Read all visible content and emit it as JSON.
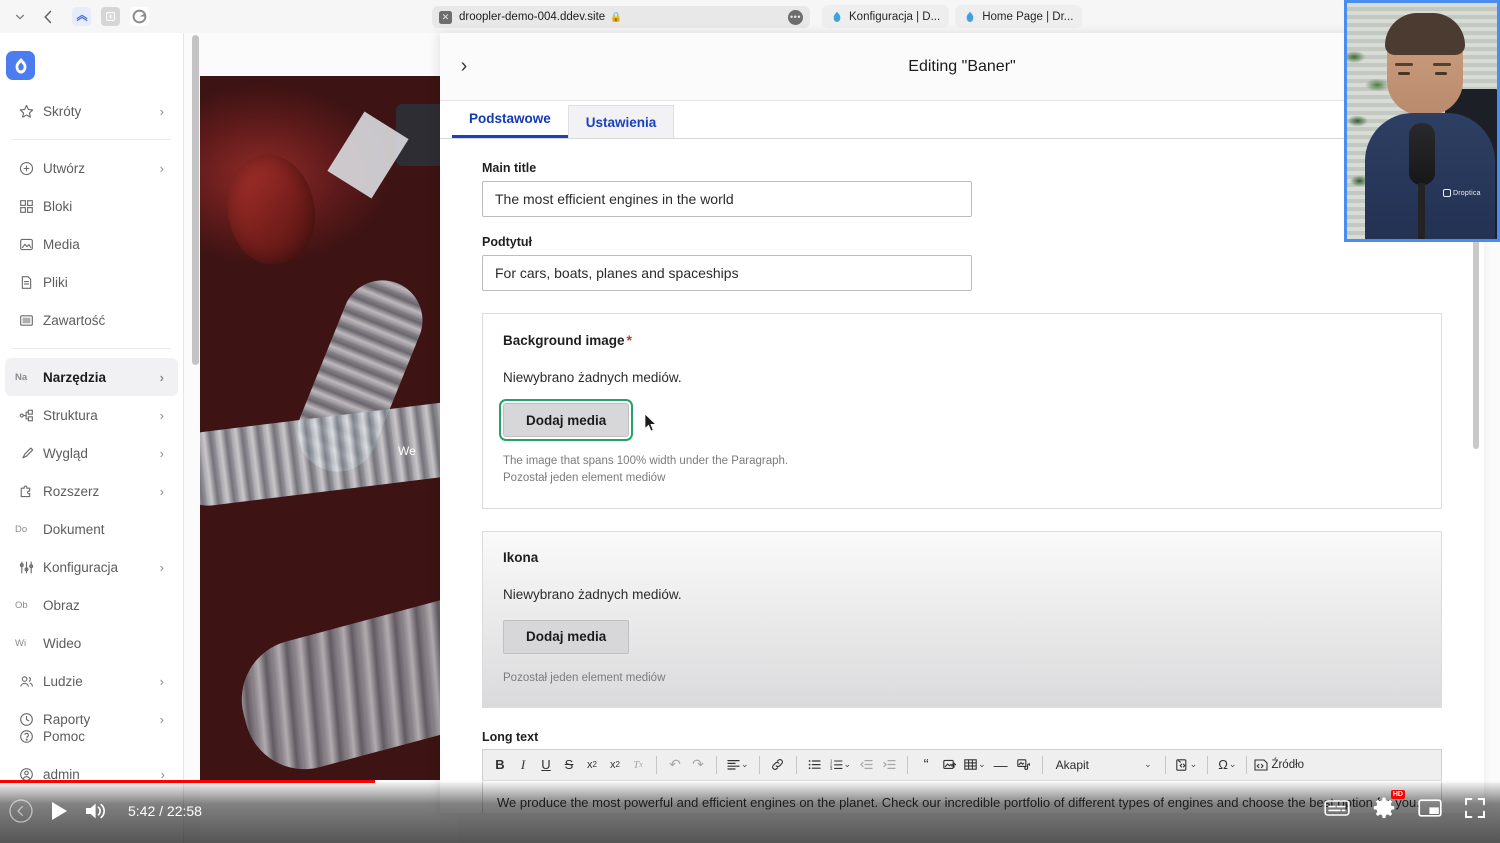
{
  "browser": {
    "toolbar_icons": [
      "sidebar-toggle-icon",
      "chevron-down-icon",
      "back-arrow-icon",
      "extension-icon-1",
      "extension-icon-2",
      "extension-icon-3"
    ],
    "address": {
      "close_glyph": "✕",
      "url": "droopler-demo-004.ddev.site",
      "lock_glyph": "🔒",
      "more_glyph": "•••"
    },
    "tabs": [
      {
        "label": "Konfiguracja | D..."
      },
      {
        "label": "Home Page | Dr..."
      }
    ]
  },
  "sidebar": {
    "logo_name": "drupal-logo",
    "items": [
      {
        "label": "Skróty",
        "icon": "star-icon",
        "chevron": "›",
        "active": false,
        "alt": ""
      },
      {
        "sep": true
      },
      {
        "label": "Utwórz",
        "icon": "plus-circle-icon",
        "chevron": "›",
        "active": false,
        "alt": ""
      },
      {
        "label": "Bloki",
        "icon": "blocks-icon",
        "chevron": "",
        "active": false,
        "alt": ""
      },
      {
        "label": "Media",
        "icon": "media-icon",
        "chevron": "",
        "active": false,
        "alt": ""
      },
      {
        "label": "Pliki",
        "icon": "files-icon",
        "chevron": "",
        "active": false,
        "alt": ""
      },
      {
        "label": "Zawartość",
        "icon": "content-icon",
        "chevron": "",
        "active": false,
        "alt": ""
      },
      {
        "sep": true
      },
      {
        "label": "Narzędzia",
        "icon": "",
        "chevron": "›",
        "active": true,
        "alt": "Na"
      },
      {
        "label": "Struktura",
        "icon": "structure-icon",
        "chevron": "›",
        "active": false,
        "alt": ""
      },
      {
        "label": "Wygląd",
        "icon": "brush-icon",
        "chevron": "›",
        "active": false,
        "alt": ""
      },
      {
        "label": "Rozszerz",
        "icon": "puzzle-icon",
        "chevron": "›",
        "active": false,
        "alt": ""
      },
      {
        "label": "Dokument",
        "icon": "",
        "chevron": "",
        "active": false,
        "alt": "Do"
      },
      {
        "label": "Konfiguracja",
        "icon": "sliders-icon",
        "chevron": "›",
        "active": false,
        "alt": ""
      },
      {
        "label": "Obraz",
        "icon": "",
        "chevron": "",
        "active": false,
        "alt": "Ob"
      },
      {
        "label": "Wideo",
        "icon": "",
        "chevron": "",
        "active": false,
        "alt": "Wi"
      },
      {
        "label": "Ludzie",
        "icon": "people-icon",
        "chevron": "›",
        "active": false,
        "alt": ""
      },
      {
        "label": "Raporty",
        "icon": "reports-icon",
        "chevron": "›",
        "active": false,
        "alt": ""
      }
    ],
    "bottom_items": [
      {
        "label": "Pomoc",
        "icon": "question-circle-icon",
        "chevron": ""
      },
      {
        "label": "admin",
        "icon": "user-circle-icon",
        "chevron": "›"
      }
    ]
  },
  "page": {
    "hero_text": "We"
  },
  "modal": {
    "close_glyph": "›",
    "title": "Editing \"Baner\"",
    "tabs": [
      {
        "label": "Podstawowe",
        "selected": true
      },
      {
        "label": "Ustawienia",
        "selected": false
      }
    ],
    "fields": {
      "main_title": {
        "label": "Main title",
        "value": "The most efficient engines in the world"
      },
      "subtitle": {
        "label": "Podtytuł",
        "value": "For cars, boats, planes and spaceships"
      }
    },
    "background_image": {
      "label": "Background image",
      "required_mark": "*",
      "empty_text": "Niewybrano żadnych mediów.",
      "button_label": "Dodaj media",
      "description_line1": "The image that spans 100% width under the Paragraph.",
      "description_line2": "Pozostał jeden element mediów"
    },
    "icon_field": {
      "label": "Ikona",
      "empty_text": "Niewybrano żadnych mediów.",
      "button_label": "Dodaj media",
      "description_line1": "Pozostał jeden element mediów"
    },
    "long_text": {
      "label": "Long text",
      "toolbar": [
        {
          "name": "bold-icon",
          "glyph": "B",
          "style": "bold"
        },
        {
          "name": "italic-icon",
          "glyph": "I",
          "style": "italic"
        },
        {
          "name": "underline-icon",
          "glyph": "U",
          "style": "underline"
        },
        {
          "name": "strikethrough-icon",
          "glyph": "S",
          "style": "strike"
        },
        {
          "name": "superscript-icon",
          "glyph": "x²",
          "style": ""
        },
        {
          "name": "subscript-icon",
          "glyph": "x₂",
          "style": ""
        },
        {
          "name": "remove-format-icon",
          "glyph": "Tₓ",
          "style": "dim"
        },
        {
          "sep": true
        },
        {
          "name": "undo-icon",
          "glyph": "↩",
          "style": "dim"
        },
        {
          "name": "redo-icon",
          "glyph": "↪",
          "style": "dim"
        },
        {
          "sep": true
        },
        {
          "name": "align-icon",
          "glyph": "≡",
          "style": "",
          "caret": true
        },
        {
          "sep": true
        },
        {
          "name": "link-icon",
          "glyph": "🔗",
          "style": ""
        },
        {
          "sep": true
        },
        {
          "name": "bulleted-list-icon",
          "glyph": "☰",
          "style": ""
        },
        {
          "name": "numbered-list-icon",
          "glyph": "≡",
          "style": "",
          "caret": true
        },
        {
          "name": "outdent-icon",
          "glyph": "←≡",
          "style": "dim"
        },
        {
          "name": "indent-icon",
          "glyph": "→≡",
          "style": "dim"
        },
        {
          "sep": true
        },
        {
          "name": "blockquote-icon",
          "glyph": "“",
          "style": ""
        },
        {
          "name": "insert-image-icon",
          "glyph": "▣",
          "style": ""
        },
        {
          "name": "insert-table-icon",
          "glyph": "▦",
          "style": "",
          "caret": true
        },
        {
          "name": "horizontal-rule-icon",
          "glyph": "—",
          "style": ""
        },
        {
          "name": "media-embed-icon",
          "glyph": "❖",
          "style": ""
        }
      ],
      "paragraph_select": {
        "value": "Akapit",
        "caret": "∨"
      },
      "template_icon": {
        "name": "template-icon",
        "caret": "∨"
      },
      "special_char": {
        "name": "special-character-icon",
        "glyph": "Ω",
        "caret": "∨"
      },
      "source_button": {
        "name": "source-button",
        "label": "Źródło",
        "glyph": "‹›"
      },
      "body_text": "We produce the most powerful and efficient engines on the planet. Check our incredible portfolio of different types of engines and choose the best option for you."
    }
  },
  "webcam": {
    "brand_label": "Droptica"
  },
  "player": {
    "prev_icon": "previous-icon",
    "play_icon": "play-icon",
    "volume_icon": "volume-icon",
    "time": "5:42 / 22:58",
    "progress_percent": 25,
    "right_controls": [
      {
        "name": "subtitles-icon"
      },
      {
        "name": "settings-gear-icon",
        "badge": "HD"
      },
      {
        "name": "miniplayer-icon"
      },
      {
        "name": "fullscreen-icon"
      }
    ]
  },
  "colors": {
    "drupal_blue": "#4b7df0",
    "tab_blue": "#1a3fbf",
    "focus_green": "#26a269",
    "required_red": "#c0392b",
    "youtube_red": "#ff0000",
    "webcam_border": "#4a8df0"
  }
}
